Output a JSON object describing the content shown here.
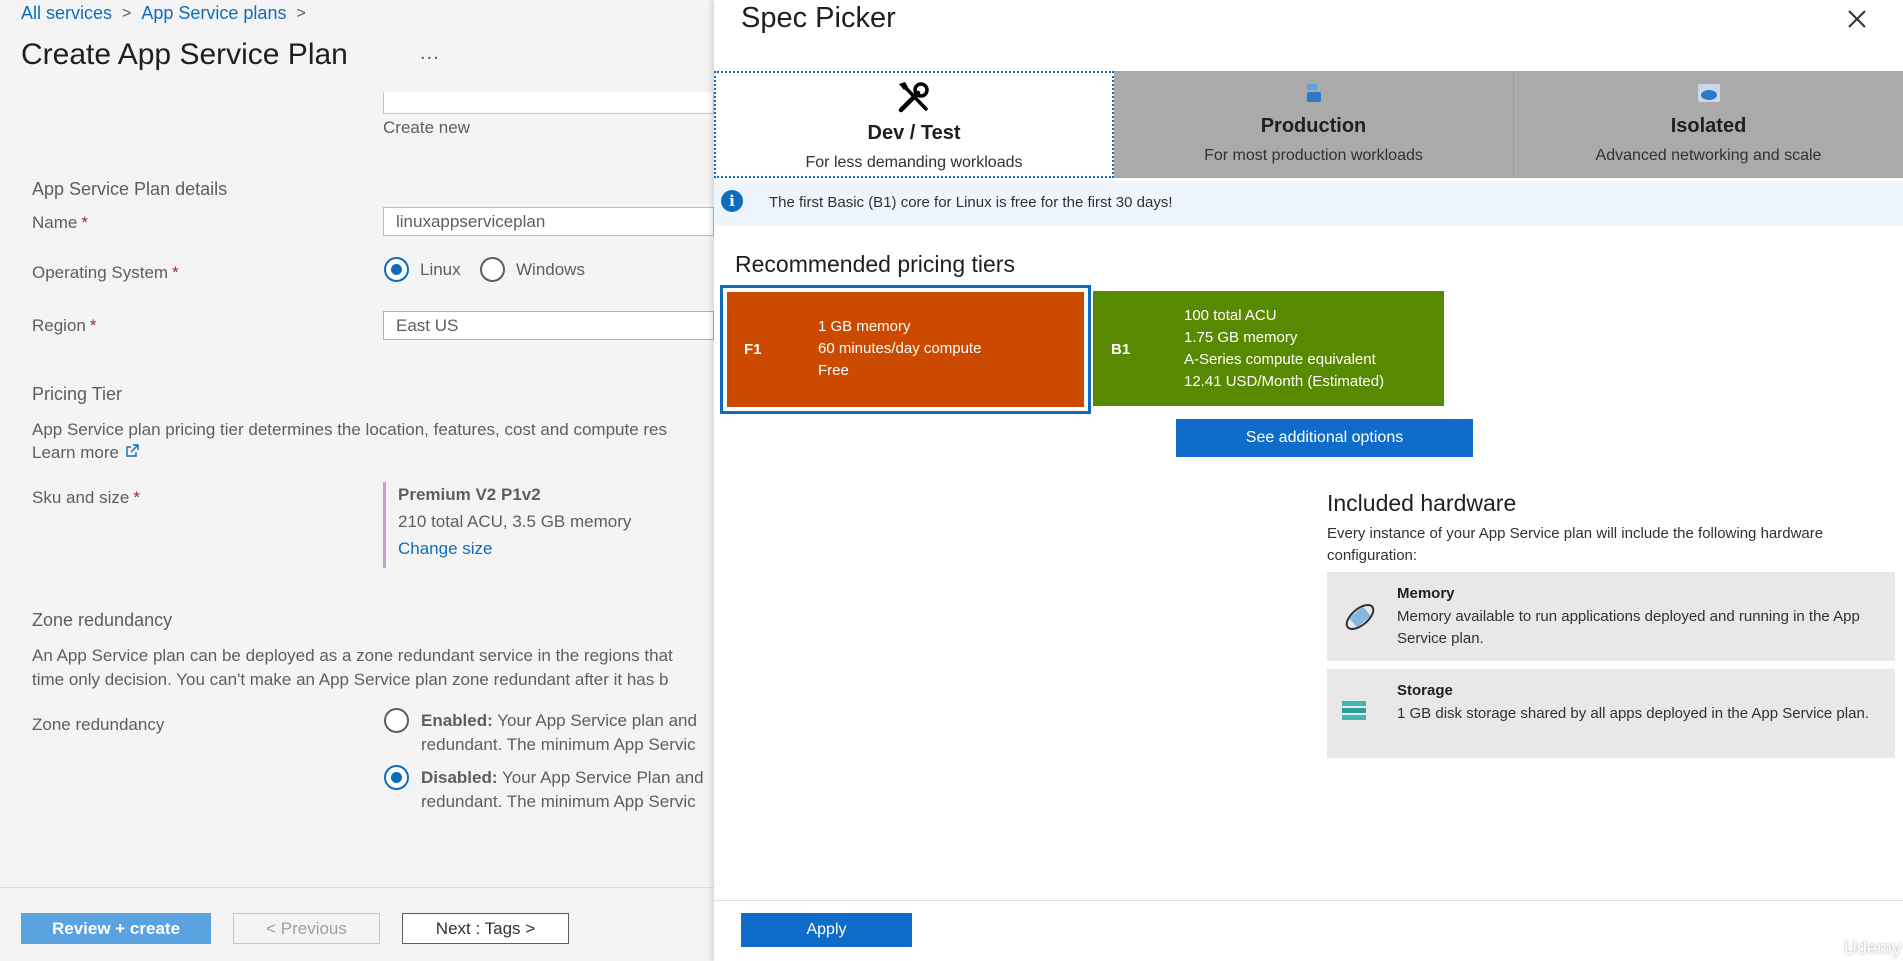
{
  "breadcrumb": {
    "all_services": "All services",
    "app_service_plans": "App Service plans",
    "sep": ">"
  },
  "page": {
    "title": "Create App Service Plan",
    "more": "..."
  },
  "form": {
    "create_new": "Create new",
    "details_heading": "App Service Plan details",
    "name_label": "Name",
    "name_value": "linuxappserviceplan",
    "required_mark": "*",
    "os_label": "Operating System",
    "os_linux": "Linux",
    "os_windows": "Windows",
    "os_selected": "Linux",
    "region_label": "Region",
    "region_value": "East US",
    "pricing_heading": "Pricing Tier",
    "pricing_desc": "App Service plan pricing tier determines the location, features, cost and compute res",
    "learn_more": "Learn more",
    "sku_label": "Sku and size",
    "sku_title": "Premium V2 P1v2",
    "sku_sub": "210 total ACU, 3.5 GB memory",
    "sku_change": "Change size",
    "zone_heading": "Zone redundancy",
    "zone_desc_1": "An App Service plan can be deployed as a zone redundant service in the regions that",
    "zone_desc_2": "time only decision. You can't make an App Service plan zone redundant after it has b",
    "zone_label": "Zone redundancy",
    "zone_enabled_bold": "Enabled:",
    "zone_enabled_1": "Your App Service plan and",
    "zone_enabled_2": "redundant. The minimum App Servic",
    "zone_disabled_bold": "Disabled:",
    "zone_disabled_1": "Your App Service Plan and",
    "zone_disabled_2": "redundant. The minimum App Servic",
    "zone_selected": "Disabled"
  },
  "footer": {
    "review": "Review + create",
    "previous": "< Previous",
    "next": "Next : Tags >"
  },
  "spec": {
    "title": "Spec Picker",
    "tabs": [
      {
        "name": "Dev / Test",
        "desc": "For less demanding workloads",
        "icon": "tools-icon",
        "active": true
      },
      {
        "name": "Production",
        "desc": "For most production workloads",
        "icon": "production-icon",
        "active": false
      },
      {
        "name": "Isolated",
        "desc": "Advanced networking and scale",
        "icon": "isolated-icon",
        "active": false
      }
    ],
    "info": "The first Basic (B1) core for Linux is free for the first 30 days!",
    "recommended": "Recommended pricing tiers",
    "tiers": [
      {
        "code": "F1",
        "lines": [
          "1 GB memory",
          "60 minutes/day compute",
          "Free"
        ],
        "color": "#cc4a00",
        "selected": true
      },
      {
        "code": "B1",
        "lines": [
          "100 total ACU",
          "1.75 GB memory",
          "A-Series compute equivalent",
          "12.41 USD/Month (Estimated)"
        ],
        "color": "#578a00",
        "selected": false
      }
    ],
    "see_more": "See additional options",
    "hw_title": "Included hardware",
    "hw_desc": "Every instance of your App Service plan will include the following hardware configuration:",
    "hardware": [
      {
        "name": "Memory",
        "desc": "Memory available to run applications deployed and running in the App Service plan.",
        "icon": "memory-icon"
      },
      {
        "name": "Storage",
        "desc": "1 GB disk storage shared by all apps deployed in the App Service plan.",
        "icon": "storage-icon"
      }
    ],
    "apply": "Apply"
  },
  "watermark": "Udemy",
  "colors": {
    "accent": "#0f6cbd",
    "f1_tier": "#cc4a00",
    "b1_tier": "#578a00",
    "primary_button": "#0f6cc9"
  }
}
